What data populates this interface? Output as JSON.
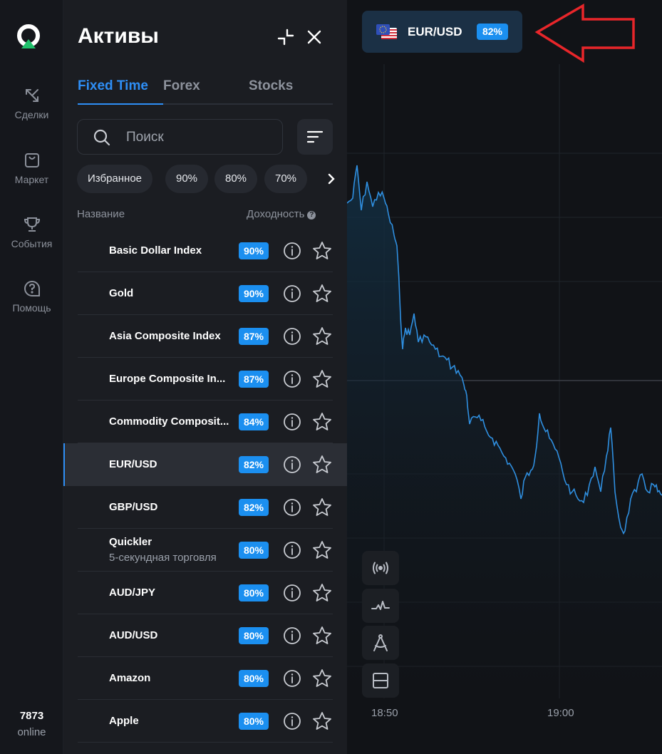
{
  "nav": {
    "items": [
      {
        "label": "Сделки",
        "icon": "trades-arrows-icon"
      },
      {
        "label": "Маркет",
        "icon": "shopping-bag-icon"
      },
      {
        "label": "События",
        "icon": "trophy-icon"
      },
      {
        "label": "Помощь",
        "icon": "help-circle-icon"
      }
    ],
    "online_count": "7873",
    "online_label": "online"
  },
  "panel": {
    "title": "Активы",
    "tabs": [
      {
        "label": "Fixed Time",
        "active": true
      },
      {
        "label": "Forex",
        "active": false
      },
      {
        "label": "Stocks",
        "active": false
      }
    ],
    "search_placeholder": "Поиск",
    "chips": [
      "Избранное",
      "90%",
      "80%",
      "70%"
    ],
    "col_name": "Название",
    "col_yield": "Доходность",
    "col_yield_help": "?",
    "assets": [
      {
        "name": "Basic Dollar Index",
        "payout": "90%"
      },
      {
        "name": "Gold",
        "payout": "90%"
      },
      {
        "name": "Asia Composite Index",
        "payout": "87%"
      },
      {
        "name": "Europe Composite In...",
        "payout": "87%"
      },
      {
        "name": "Commodity Composit...",
        "payout": "84%"
      },
      {
        "name": "EUR/USD",
        "payout": "82%",
        "selected": true
      },
      {
        "name": "GBP/USD",
        "payout": "82%"
      },
      {
        "name": "Quickler",
        "sub": "5-секундная торговля",
        "payout": "80%"
      },
      {
        "name": "AUD/JPY",
        "payout": "80%"
      },
      {
        "name": "AUD/USD",
        "payout": "80%"
      },
      {
        "name": "Amazon",
        "payout": "80%"
      },
      {
        "name": "Apple",
        "payout": "80%"
      }
    ]
  },
  "chart": {
    "asset_symbol": "EUR/USD",
    "asset_payout": "82%",
    "time_labels": [
      "18:50",
      "19:00"
    ],
    "line_color": "#2f8fe0",
    "annotation_color": "#e8262a"
  }
}
